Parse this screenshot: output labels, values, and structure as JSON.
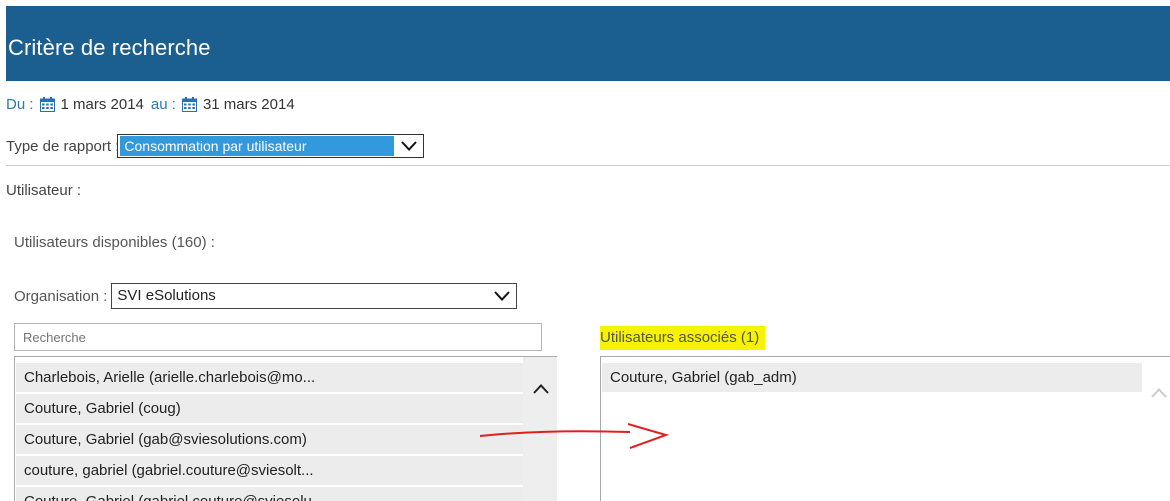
{
  "header": {
    "title": "Critère de recherche"
  },
  "dates": {
    "from_label": "Du :",
    "from_value": "1 mars 2014",
    "to_label": "au :",
    "to_value": "31 mars 2014"
  },
  "report": {
    "label": "Type de rapport :",
    "value": "Consommation par utilisateur"
  },
  "user_label": "Utilisateur :",
  "available": {
    "label": "Utilisateurs disponibles (160) :",
    "org_label": "Organisation :",
    "org_value": "SVI eSolutions",
    "search_placeholder": "Recherche",
    "items": [
      "Charlebois, Arielle (arielle.charlebois@mo...",
      "Couture, Gabriel (coug)",
      "Couture, Gabriel (gab@sviesolutions.com)",
      "couture, gabriel (gabriel.couture@sviesolt...",
      "Couture, Gabriel (gabriel.couture@sviesolu..."
    ]
  },
  "associated": {
    "label": "Utilisateurs associés (1)",
    "items": [
      "Couture, Gabriel (gab_adm)"
    ]
  },
  "icons": {
    "calendar": "calendar-icon",
    "dropdown": "chevron-down-icon",
    "scroll_up": "chevron-up-icon",
    "annotation": "arrow-icon"
  },
  "colors": {
    "header_bg": "#1a5f8f",
    "selected_bg": "#3399dd",
    "highlight": "#f7f300",
    "annotation": "#e02020"
  }
}
